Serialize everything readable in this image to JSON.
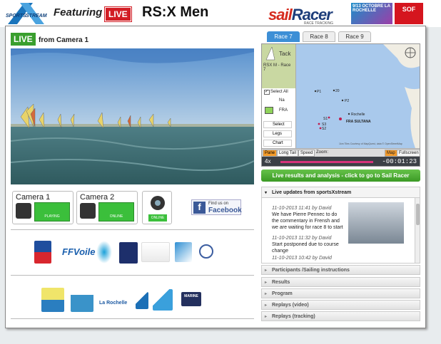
{
  "header": {
    "logo_text": "SPORTS XSTREAM",
    "featuring": "Featuring",
    "live": "LIVE",
    "title": "RS:X Men",
    "sponsor_sail": "sail",
    "sponsor_racer": "Racer",
    "sponsor_sub": "RACE TRACKING",
    "ad_text": "9/13 OCTOBRE LA ROCHELLE",
    "sof_text": "SOF"
  },
  "player": {
    "live": "LIVE",
    "source": "from Camera 1"
  },
  "cameras": [
    {
      "label": "Camera 1",
      "status": "PLAYING"
    },
    {
      "label": "Camera 2",
      "status": "ONLINE"
    }
  ],
  "webcam": {
    "status": "ONLINE"
  },
  "facebook": {
    "find": "Find us on",
    "name": "Facebook"
  },
  "race_tabs": [
    "Race 7",
    "Race 8",
    "Race 9"
  ],
  "map": {
    "tack": "Tack",
    "race": "RSX M - Race 7",
    "select_all": "Select All",
    "col": "Na",
    "fra": "FRA",
    "buttons": [
      "Select",
      "Legs",
      "Chart"
    ],
    "place1": "La Rochelle",
    "boat": "FRA SULTANA",
    "controls": [
      "Pane",
      "Long Tail",
      "Speed",
      "Zoom:",
      "Map",
      "Fullscreen"
    ],
    "time": "-00:01:23",
    "speed": "4x",
    "credit": "1km  Tiles Courtesy of MapQuest, data © OpenStreetMap"
  },
  "results_link": "Live results and analysis - click to go to Sail Racer",
  "updates": {
    "title": "Live updates from sportsXstream",
    "items": [
      {
        "date": "11-10-2013 11:41 by David",
        "text": "We have Pierre Pennec to do the commentary in Frensh and we are waiting for race 8 to start"
      },
      {
        "date": "11-10-2013 11:32 by David",
        "text": "Start postponed due to course change"
      },
      {
        "date": "11-10-2013 10:42 by David",
        "text": ""
      }
    ]
  },
  "accordion": [
    "Participants /Sailing instructions",
    "Results",
    "Program",
    "Replays (video)",
    "Replays (tracking)"
  ],
  "sponsors": {
    "ffvoile": "FFVoile",
    "poitou": "Poitou Charentes",
    "charente": "la Charente Maritime",
    "agglo": "Communauté d'Agglomération de La Rochelle",
    "marine": "MARINE",
    "agglo_name": "La Rochelle"
  },
  "colors": {
    "live_green": "#3a9f2e",
    "live_red": "#d21d24",
    "tab_blue": "#3d8fd6",
    "results_green": "#4fae35"
  }
}
